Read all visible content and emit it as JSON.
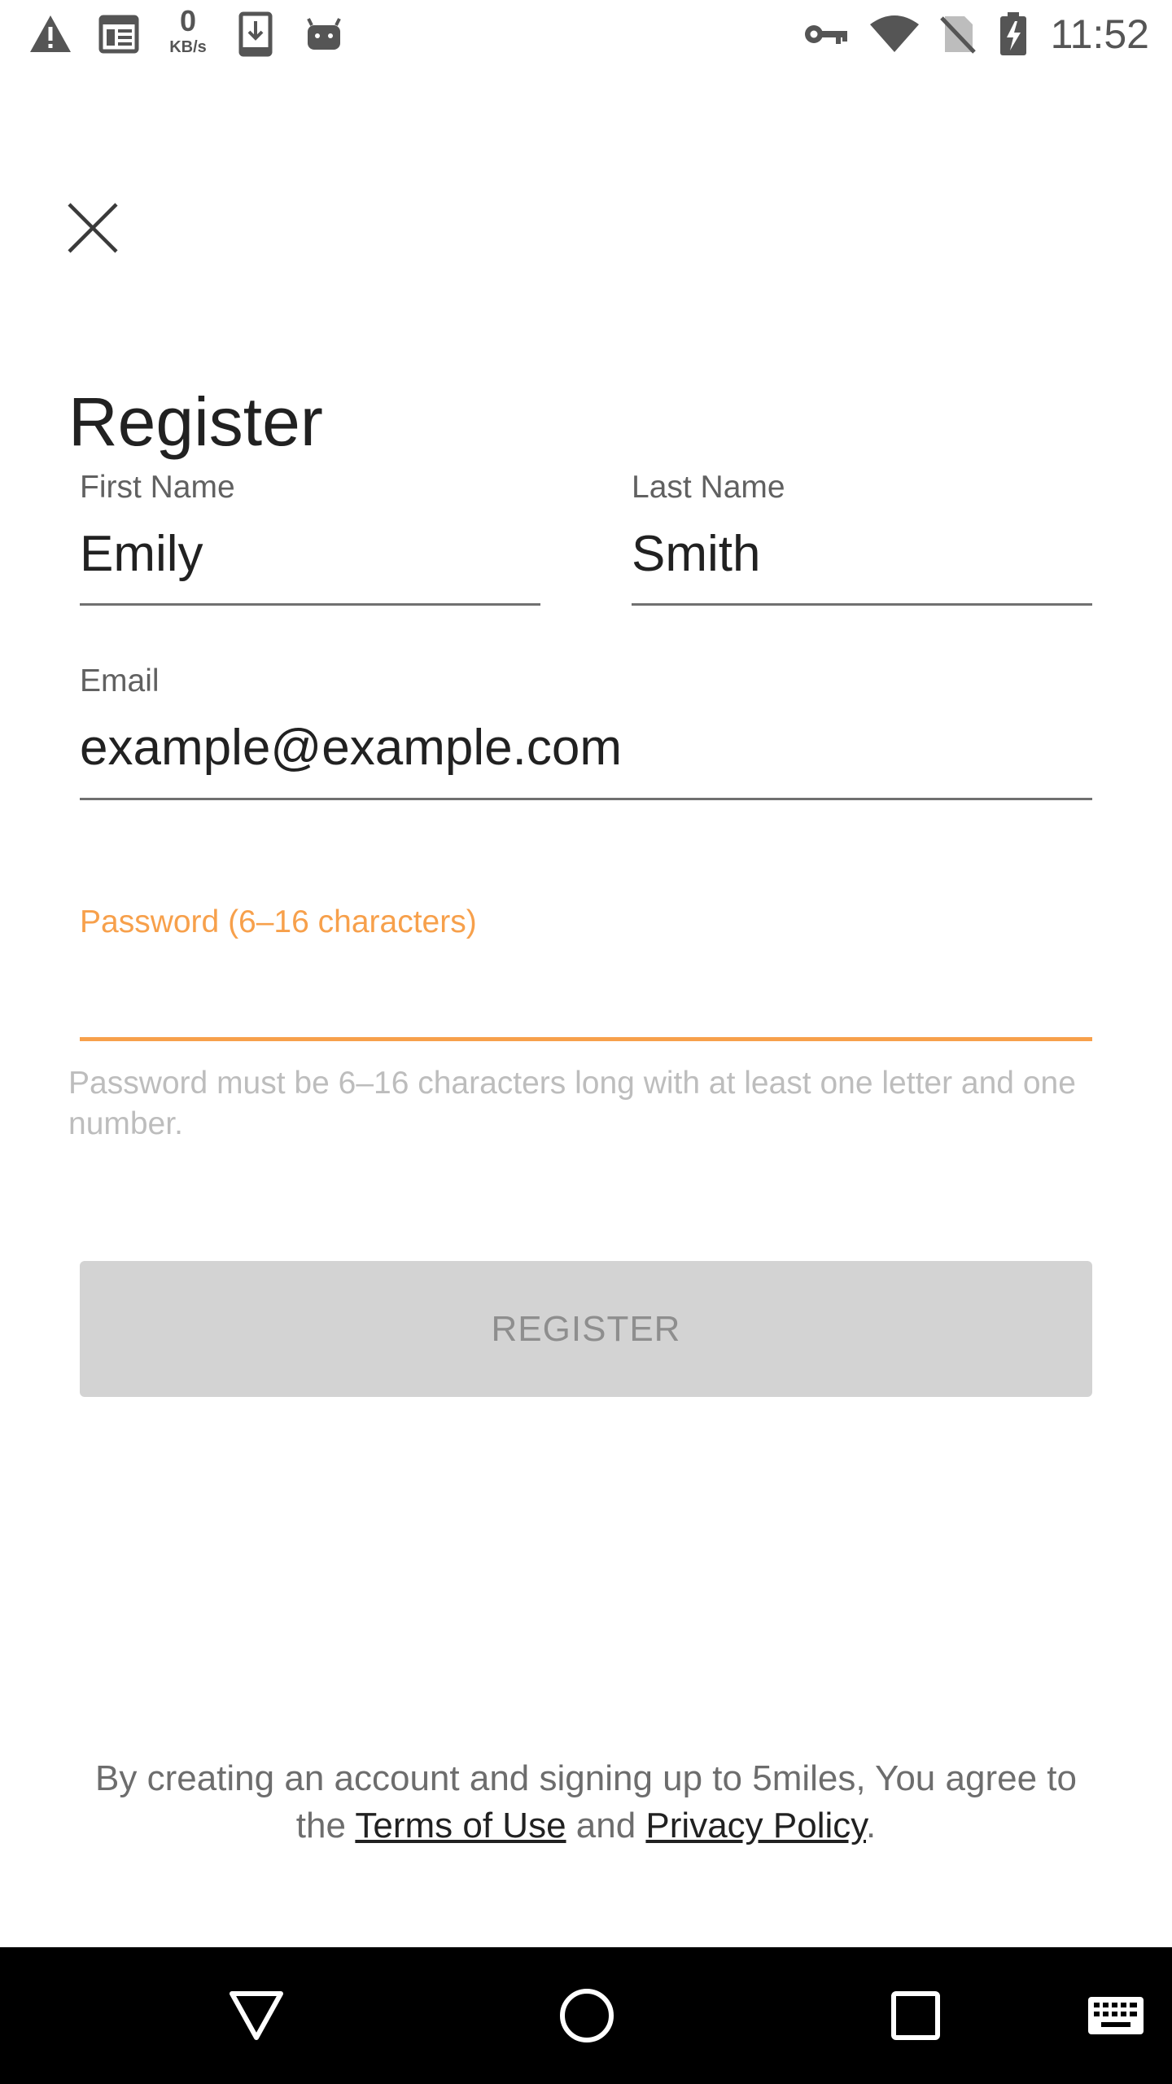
{
  "status_bar": {
    "icons": [
      "warning-icon",
      "news-icon",
      "data-speed-icon",
      "download-icon",
      "android-icon",
      "vpn-key-icon",
      "wifi-icon",
      "no-sim-icon",
      "battery-charging-icon"
    ],
    "speed_value": "0",
    "speed_unit": "KB/s",
    "time": "11:52"
  },
  "header": {
    "close_icon": "close-icon",
    "title": "Register"
  },
  "form": {
    "first_name": {
      "label": "First Name",
      "value": "Emily"
    },
    "last_name": {
      "label": "Last Name",
      "value": "Smith"
    },
    "email": {
      "label": "Email",
      "value": "example@example.com"
    },
    "password": {
      "label": "Password (6–16 characters)",
      "value": ""
    },
    "password_helper": "Password must be 6–16 characters long with at least one letter and one number.",
    "submit_label": "REGISTER"
  },
  "terms": {
    "prefix": "By creating an account and signing up to 5miles, You agree to the ",
    "terms_link": "Terms of Use",
    "middle": " and ",
    "privacy_link": "Privacy Policy",
    "suffix": "."
  },
  "colors": {
    "accent": "#f7a04b",
    "button_disabled_bg": "#d3d3d3",
    "button_disabled_text": "#8e8e8e",
    "nav_bar": "#000000"
  },
  "nav_bar": {
    "icons": [
      "back-icon",
      "home-icon",
      "recents-icon",
      "keyboard-icon"
    ]
  }
}
